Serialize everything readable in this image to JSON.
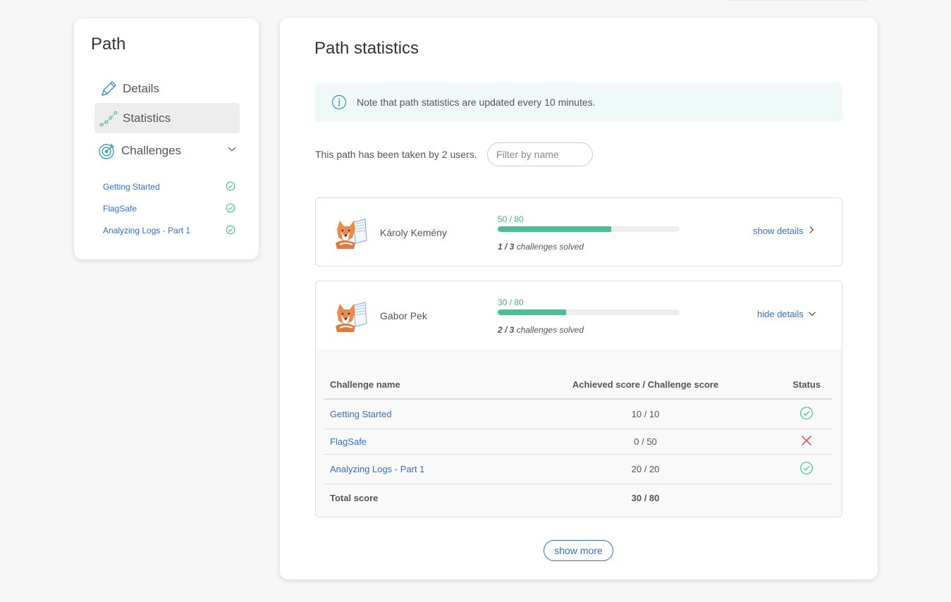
{
  "sidebar": {
    "title": "Path",
    "items": [
      {
        "label": "Details",
        "icon": "pencil-icon"
      },
      {
        "label": "Statistics",
        "icon": "chart-line-icon"
      },
      {
        "label": "Challenges",
        "icon": "target-icon"
      }
    ],
    "challenges": [
      {
        "label": "Getting Started",
        "status": "solved"
      },
      {
        "label": "FlagSafe",
        "status": "solved"
      },
      {
        "label": "Analyzing Logs - Part 1",
        "status": "solved"
      }
    ]
  },
  "main": {
    "title": "Path statistics",
    "note": "Note that path statistics are updated every 10 minutes.",
    "taken_text": "This path has been taken by 2 users.",
    "filter_placeholder": "Filter by name",
    "users": [
      {
        "name": "Károly Kemény",
        "score_text": "50 / 80",
        "progress": 0.625,
        "solved_count": "1 / 3",
        "solved_suffix": " challenges solved",
        "details_label": "show details"
      },
      {
        "name": "Gabor Pek",
        "score_text": "30 / 80",
        "progress": 0.375,
        "solved_count": "2 / 3",
        "solved_suffix": " challenges solved",
        "details_label": "hide details"
      }
    ],
    "table": {
      "headers": [
        "Challenge name",
        "Achieved score / Challenge score",
        "Status"
      ],
      "rows": [
        {
          "name": "Getting Started",
          "score": "10 / 10",
          "status": "solved"
        },
        {
          "name": "FlagSafe",
          "score": "0 / 50",
          "status": "failed"
        },
        {
          "name": "Analyzing Logs - Part 1",
          "score": "20 / 20",
          "status": "solved"
        }
      ],
      "total_label": "Total score",
      "total_score": "30 / 80"
    },
    "show_more": "show more"
  },
  "colors": {
    "accent": "#4dbd98",
    "link": "#2f6fcf",
    "error": "#e04545"
  }
}
